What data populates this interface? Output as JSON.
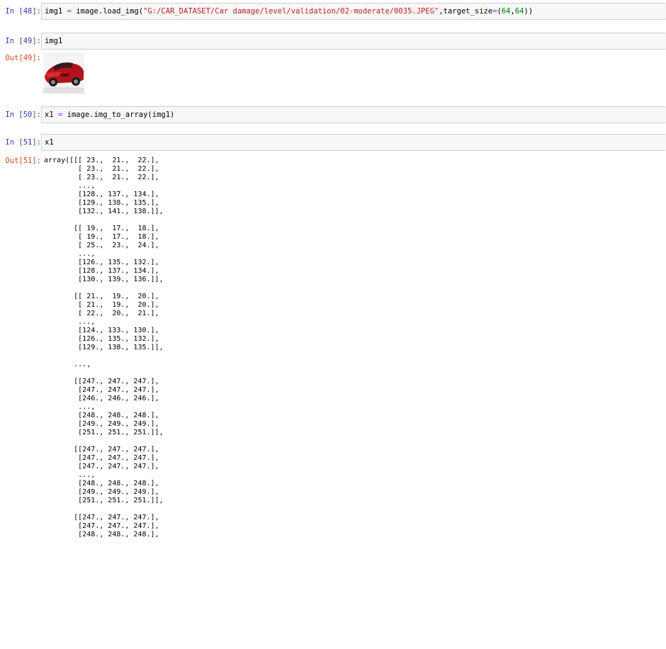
{
  "cells": {
    "c48": {
      "prompt": "In [48]:",
      "code": {
        "var": "img1",
        "assign": " = image.load_img(",
        "path": "\"G:/CAR_DATASET/Car damage/level/validation/02-moderate/0035.JPEG\"",
        "kw": ",target_size",
        "eq": "=",
        "open": "(",
        "n1": "64",
        "comma": ",",
        "n2": "64",
        "close": "))"
      }
    },
    "c49": {
      "prompt": "In [49]:",
      "code": "img1",
      "out_prompt": "Out[49]:",
      "image_alt": "red car thumbnail"
    },
    "c50": {
      "prompt": "In [50]:",
      "code": {
        "var": "x1",
        "assign": " = image.img_to_array(img1)"
      }
    },
    "c51": {
      "prompt": "In [51]:",
      "code": "x1",
      "out_prompt": "Out[51]:",
      "output": "array([[[ 23.,  21.,  22.],\n        [ 23.,  21.,  22.],\n        [ 23.,  21.,  22.],\n        ...,\n        [128., 137., 134.],\n        [129., 138., 135.],\n        [132., 141., 138.]],\n\n       [[ 19.,  17.,  18.],\n        [ 19.,  17.,  18.],\n        [ 25.,  23.,  24.],\n        ...,\n        [126., 135., 132.],\n        [128., 137., 134.],\n        [130., 139., 136.]],\n\n       [[ 21.,  19.,  20.],\n        [ 21.,  19.,  20.],\n        [ 22.,  20.,  21.],\n        ...,\n        [124., 133., 130.],\n        [126., 135., 132.],\n        [129., 138., 135.]],\n\n       ...,\n\n       [[247., 247., 247.],\n        [247., 247., 247.],\n        [246., 246., 246.],\n        ...,\n        [248., 248., 248.],\n        [249., 249., 249.],\n        [251., 251., 251.]],\n\n       [[247., 247., 247.],\n        [247., 247., 247.],\n        [247., 247., 247.],\n        ...,\n        [248., 248., 248.],\n        [249., 249., 249.],\n        [251., 251., 251.]],\n\n       [[247., 247., 247.],\n        [247., 247., 247.],\n        [248., 248., 248.],"
    }
  },
  "colors": {
    "in_prompt": "#303f9f",
    "out_prompt": "#d84315",
    "string": "#ba2121",
    "number": "#008000",
    "operator": "#aa22ff",
    "input_bg": "#f7f7f7",
    "input_border": "#cfcfcf"
  }
}
